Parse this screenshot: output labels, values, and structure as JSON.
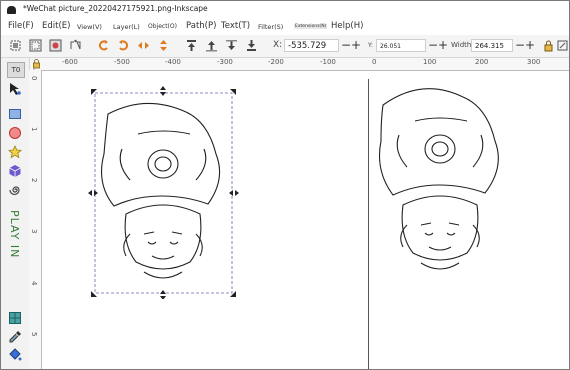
{
  "window": {
    "title": "*WeChat picture_20220427175921.png-Inkscape"
  },
  "menu": [
    {
      "key": "file",
      "label": "File(F)"
    },
    {
      "key": "edit",
      "label": "Edit(E)"
    },
    {
      "key": "view",
      "label": "View(V)"
    },
    {
      "key": "layer",
      "label": "Layer(L)"
    },
    {
      "key": "object",
      "label": "Object(O)"
    },
    {
      "key": "path",
      "label": "Path(P)"
    },
    {
      "key": "text",
      "label": "Text(T)"
    },
    {
      "key": "filter",
      "label": "Filter(S)"
    },
    {
      "key": "extensions",
      "label": "Extensions(N)"
    },
    {
      "key": "help",
      "label": "Help(H)"
    }
  ],
  "toolbar": {
    "x_label": "X:",
    "x_value": "-535.729",
    "y_label": "Y:",
    "y_value": "26.051",
    "width_label": "Width:",
    "width_value": "264.315",
    "minus": "−",
    "plus": "+"
  },
  "toolbox": {
    "vertical_text": "PLAY IN",
    "text_tool": "T0"
  },
  "ruler": {
    "h_labels": [
      "-600",
      "-500",
      "-400",
      "-300",
      "-200",
      "-100",
      "0",
      "100",
      "200",
      "300"
    ],
    "v_labels": [
      "0",
      "1",
      "2",
      "3",
      "4",
      "5"
    ]
  },
  "colors": {
    "accent_orange": "#e07a1f",
    "selection_dash": "#6666aa",
    "toolbox_text": "#2e7d32"
  }
}
